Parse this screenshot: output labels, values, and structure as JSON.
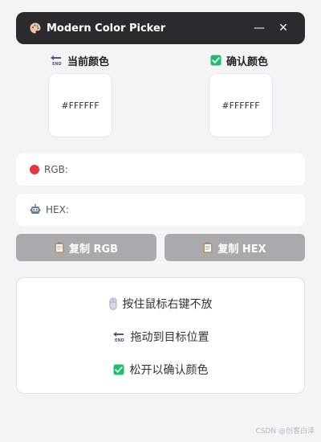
{
  "window": {
    "title": "Modern Color Picker",
    "minimize_label": "—",
    "close_label": "✕",
    "app_icon": "palette-icon"
  },
  "current_color": {
    "label": "当前颜色",
    "value": "#FFFFFF",
    "icon": "end-arrow-icon"
  },
  "confirm_color": {
    "label": "确认颜色",
    "value": "#FFFFFF",
    "icon": "checkbox-icon"
  },
  "fields": {
    "rgb_label": "RGB:",
    "rgb_value": "",
    "hex_label": "HEX:",
    "hex_value": ""
  },
  "buttons": {
    "copy_rgb": "复制 RGB",
    "copy_hex": "复制 HEX"
  },
  "instructions": {
    "step1": "按住鼠标右键不放",
    "step2": "拖动到目标位置",
    "step3": "松开以确认颜色"
  },
  "watermark": "CSDN @创客白泽",
  "colors": {
    "titlebar": "#2b2b2f",
    "background": "#f4f4f7",
    "button": "#a9a9ae",
    "check_green": "#1ec06a",
    "red_dot": "#e8343a",
    "end_arrow": "#5a4f8c"
  }
}
